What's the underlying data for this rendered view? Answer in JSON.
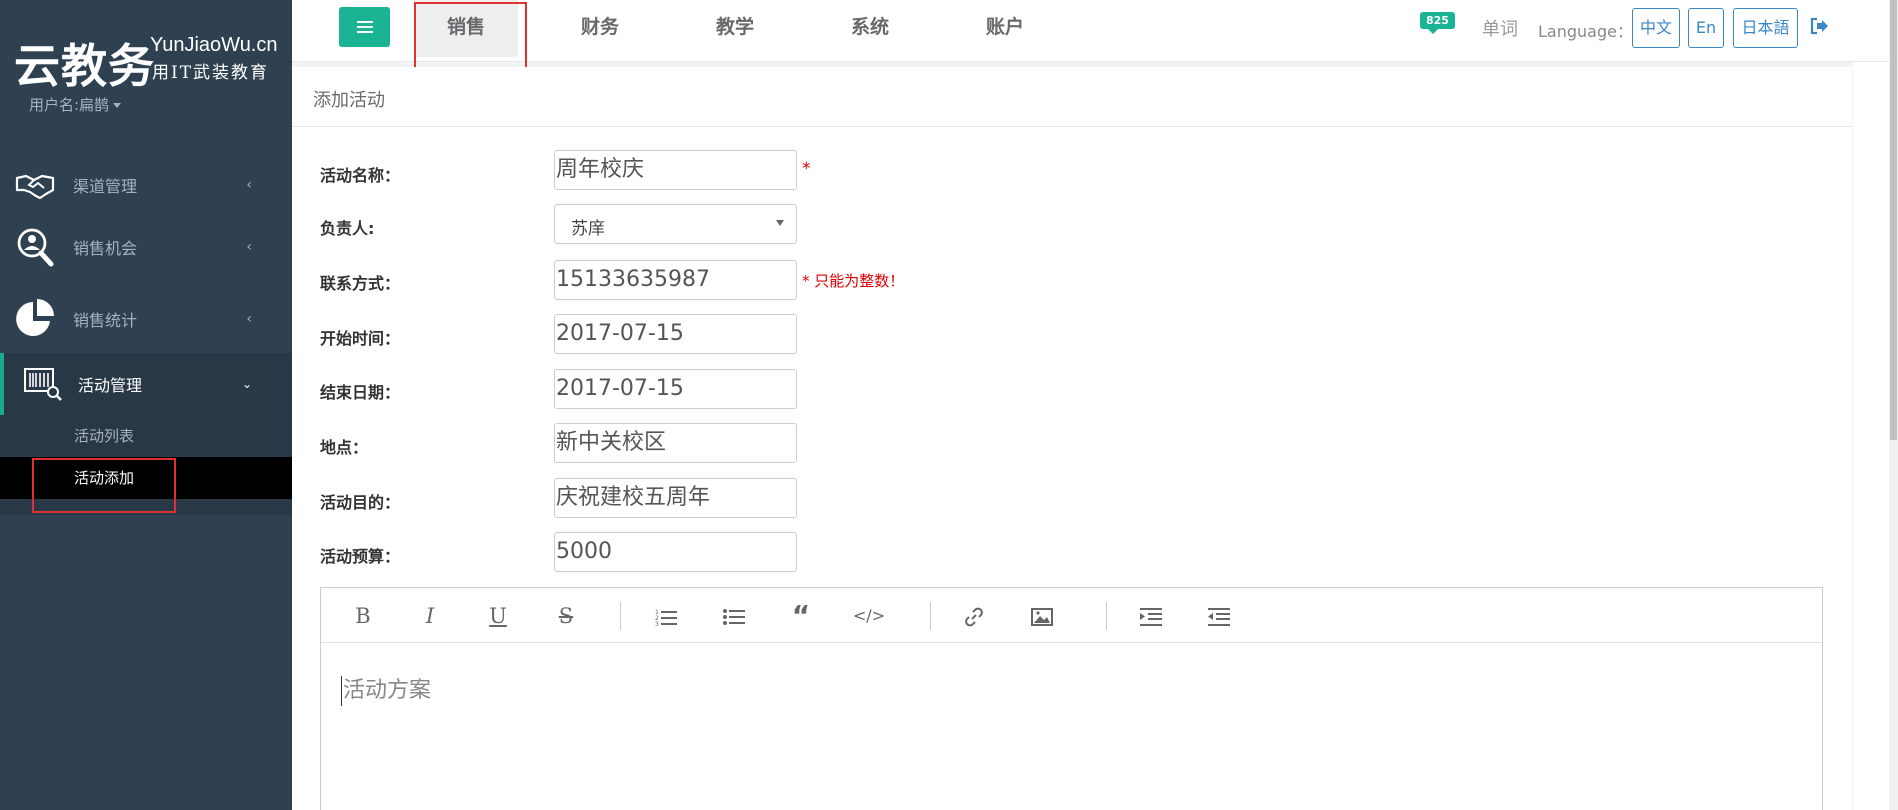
{
  "sidebar": {
    "brand_cn": "云教务",
    "brand_en": "YunJiaoWu.cn",
    "brand_sub": "用IT武装教育",
    "username": "用户名:扁鹊",
    "nav": [
      {
        "label": "渠道管理",
        "icon": "handshake-icon"
      },
      {
        "label": "销售机会",
        "icon": "search-people-icon"
      },
      {
        "label": "销售统计",
        "icon": "pie-chart-icon"
      },
      {
        "label": "活动管理",
        "icon": "activity-scan-icon"
      }
    ],
    "sub_items": [
      "活动列表",
      "活动添加"
    ]
  },
  "topbar": {
    "tabs": [
      "销售",
      "财务",
      "教学",
      "系统",
      "账户"
    ],
    "active_tab": "销售",
    "message_count": "825",
    "words_link": "单词",
    "language_label": "Language：",
    "languages": [
      "中文",
      "En",
      "日本語"
    ]
  },
  "panel": {
    "title": "添加活动"
  },
  "form": {
    "activity_name_label": "活动名称：",
    "activity_name_value": "周年校庆",
    "owner_label": "负责人:",
    "owner_value": "苏庠",
    "contact_label": "联系方式：",
    "contact_value": "15133635987",
    "contact_error": "* 只能为整数！",
    "start_label": "开始时间：",
    "start_value": "2017-07-15",
    "end_label": "结束日期：",
    "end_value": "2017-07-15",
    "place_label": "地点：",
    "place_value": "新中关校区",
    "purpose_label": "活动目的：",
    "purpose_value": "庆祝建校五周年",
    "budget_label": "活动预算：",
    "budget_value": "5000",
    "required_mark": "*"
  },
  "editor": {
    "placeholder": "活动方案",
    "toolbar": [
      "B",
      "I",
      "U",
      "S"
    ]
  },
  "colors": {
    "sidebar_bg": "#2f4050",
    "accent": "#1ab394",
    "link_blue": "#3a87c8",
    "error_red": "#e00000"
  }
}
